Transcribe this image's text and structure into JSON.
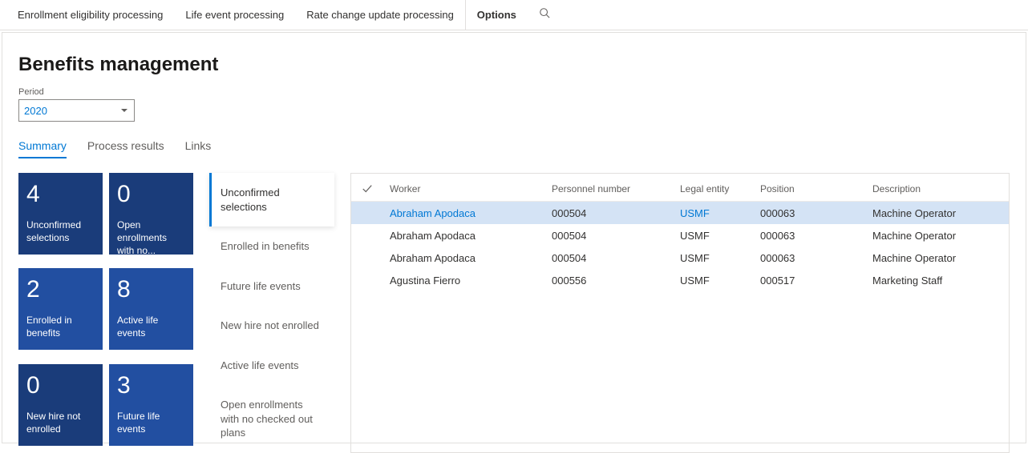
{
  "ribbon": {
    "items": [
      "Enrollment eligibility processing",
      "Life event processing",
      "Rate change update processing",
      "Options"
    ]
  },
  "page": {
    "title": "Benefits management"
  },
  "period": {
    "label": "Period",
    "value": "2020"
  },
  "tabs": {
    "items": [
      {
        "label": "Summary",
        "active": true
      },
      {
        "label": "Process results",
        "active": false
      },
      {
        "label": "Links",
        "active": false
      }
    ]
  },
  "tiles": [
    {
      "count": "4",
      "label": "Unconfirmed selections",
      "dark": true
    },
    {
      "count": "0",
      "label": "Open enrollments with no...",
      "dark": true
    },
    {
      "count": "2",
      "label": "Enrolled in benefits",
      "dark": false
    },
    {
      "count": "8",
      "label": "Active life events",
      "dark": false
    },
    {
      "count": "0",
      "label": "New hire not enrolled",
      "dark": true
    },
    {
      "count": "3",
      "label": "Future life events",
      "dark": false
    }
  ],
  "categories": [
    {
      "label": "Unconfirmed selections",
      "selected": true
    },
    {
      "label": "Enrolled in benefits",
      "selected": false
    },
    {
      "label": "Future life events",
      "selected": false
    },
    {
      "label": "New hire not enrolled",
      "selected": false
    },
    {
      "label": "Active life events",
      "selected": false
    },
    {
      "label": "Open enrollments with no checked out plans",
      "selected": false
    }
  ],
  "grid": {
    "columns": {
      "worker": "Worker",
      "personnel": "Personnel number",
      "legal": "Legal entity",
      "position": "Position",
      "description": "Description"
    },
    "rows": [
      {
        "worker": "Abraham Apodaca",
        "personnel": "000504",
        "legal": "USMF",
        "position": "000063",
        "description": "Machine Operator",
        "selected": true
      },
      {
        "worker": "Abraham Apodaca",
        "personnel": "000504",
        "legal": "USMF",
        "position": "000063",
        "description": "Machine Operator",
        "selected": false
      },
      {
        "worker": "Abraham Apodaca",
        "personnel": "000504",
        "legal": "USMF",
        "position": "000063",
        "description": "Machine Operator",
        "selected": false
      },
      {
        "worker": "Agustina Fierro",
        "personnel": "000556",
        "legal": "USMF",
        "position": "000517",
        "description": "Marketing Staff",
        "selected": false
      }
    ]
  }
}
